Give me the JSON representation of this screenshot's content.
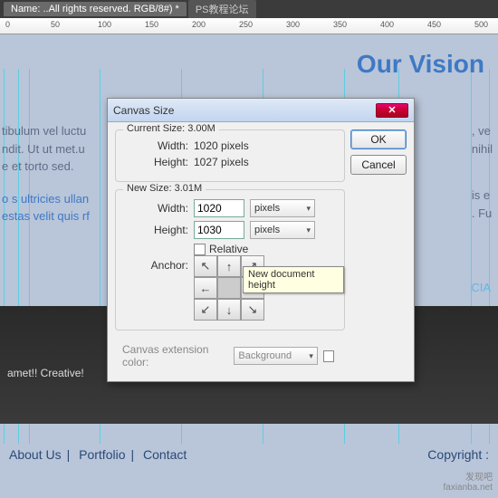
{
  "tabs": {
    "active": "Name: ..All rights reserved. RGB/8#) *",
    "other": "PS教程论坛"
  },
  "ruler": [
    "0",
    "50",
    "100",
    "150",
    "200",
    "250",
    "300",
    "350",
    "400",
    "450",
    "500"
  ],
  "bg": {
    "vision": "Our Vision",
    "body1": "tibulum vel luctu",
    "body2": "ndit. Ut ut met.u",
    "body3": "e et torto sed.",
    "body4": "o s ultricies ullan",
    "body5": "estas velit quis rf",
    "right1": ", ve",
    "right2": "nihil",
    "right3": "is e",
    "right4": ". Fu",
    "social": "CIA",
    "tagline": "amet!! Creative!",
    "footer": {
      "about": "About Us",
      "portfolio": "Portfolio",
      "contact": "Contact",
      "copyright": "Copyright :"
    }
  },
  "dialog": {
    "title": "Canvas Size",
    "ok": "OK",
    "cancel": "Cancel",
    "current": {
      "legend": "Current Size: 3.00M",
      "width_l": "Width:",
      "width_v": "1020 pixels",
      "height_l": "Height:",
      "height_v": "1027 pixels"
    },
    "new": {
      "legend": "New Size: 3.01M",
      "width_l": "Width:",
      "width_v": "1020",
      "width_u": "pixels",
      "height_l": "Height:",
      "height_v": "1030",
      "height_u": "pixels",
      "relative": "Relative",
      "anchor_l": "Anchor:",
      "tooltip": "New document height"
    },
    "ext": {
      "label": "Canvas extension color:",
      "value": "Background"
    }
  },
  "watermark": {
    "l1": "发现吧",
    "l2": "faxianba.net"
  }
}
